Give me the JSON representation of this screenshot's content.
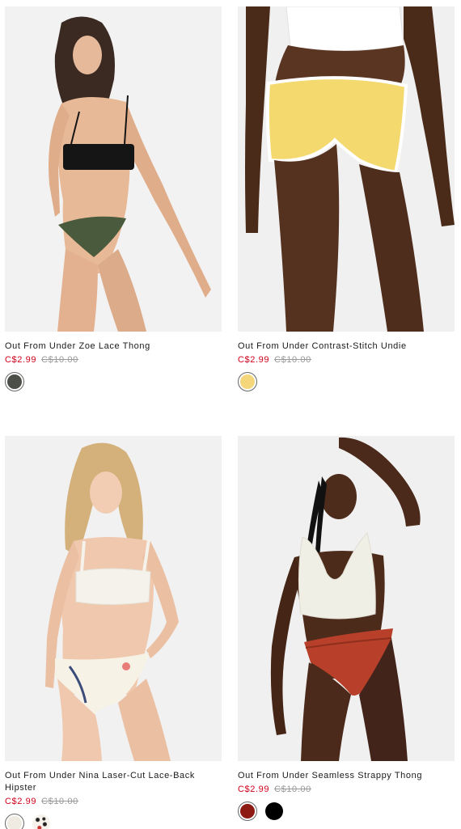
{
  "products": [
    {
      "name": "Out From Under Zoe Lace Thong",
      "sale_price": "C$2.99",
      "original_price": "C$10.00",
      "swatches": [
        {
          "color": "#4b4f47",
          "selected": true
        }
      ]
    },
    {
      "name": "Out From Under Contrast-Stitch Undie",
      "sale_price": "C$2.99",
      "original_price": "C$10.00",
      "swatches": [
        {
          "color": "#f4d77b",
          "selected": true
        }
      ]
    },
    {
      "name": "Out From Under Nina Laser-Cut Lace-Back Hipster",
      "sale_price": "C$2.99",
      "original_price": "C$10.00",
      "swatches": [
        {
          "color": "#efebe3",
          "selected": true
        },
        {
          "color": "pattern",
          "selected": false
        }
      ]
    },
    {
      "name": "Out From Under Seamless Strappy Thong",
      "sale_price": "C$2.99",
      "original_price": "C$10.00",
      "swatches": [
        {
          "color": "#8e1a14",
          "selected": true
        },
        {
          "color": "#000000",
          "selected": false
        }
      ]
    }
  ],
  "colors": {
    "sale": "#d0021b",
    "original": "#999999",
    "image_bg": "#f3f3f3"
  }
}
